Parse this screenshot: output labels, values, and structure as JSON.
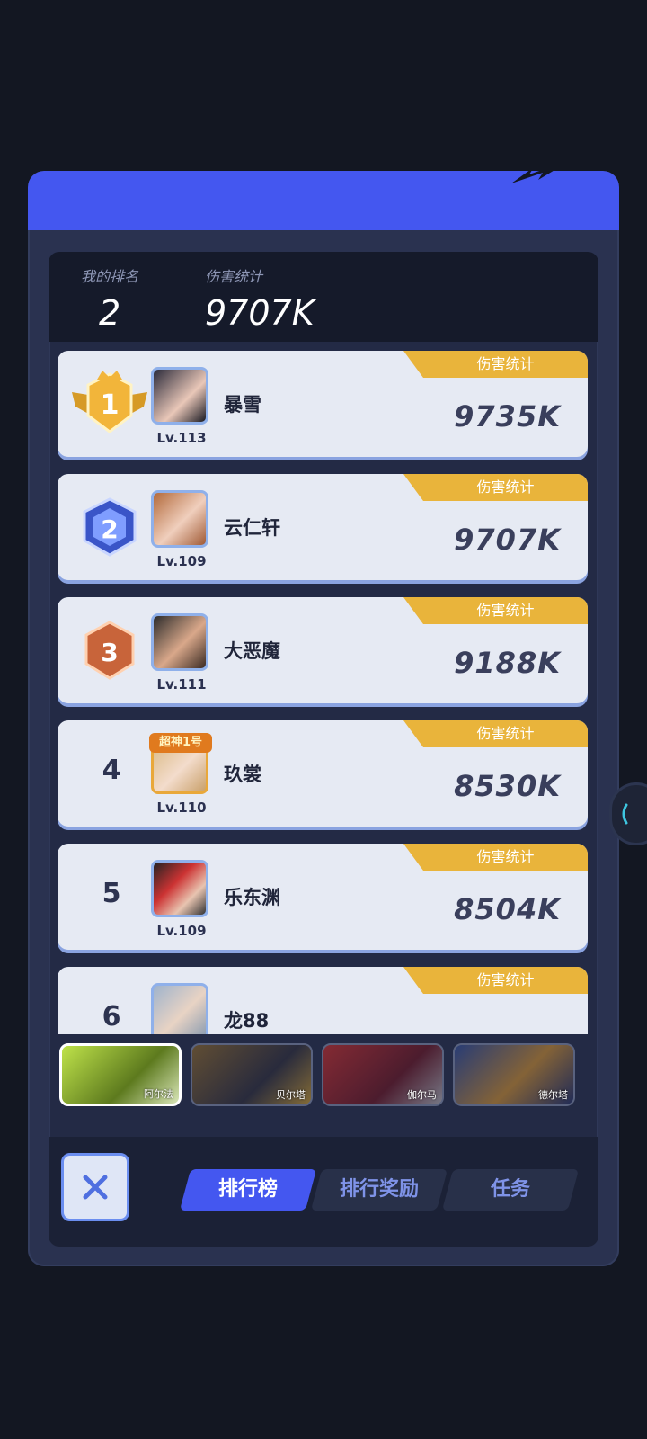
{
  "my_rank": {
    "rank_label": "我的排名",
    "rank_value": "2",
    "damage_label": "伤害统计",
    "damage_value": "9707K"
  },
  "ranking": [
    {
      "rank": "1",
      "name": "暴雪",
      "level": "Lv.113",
      "tag": "伤害统计",
      "score": "9735K",
      "badge": "gold"
    },
    {
      "rank": "2",
      "name": "云仁轩",
      "level": "Lv.109",
      "tag": "伤害统计",
      "score": "9707K",
      "badge": "blue"
    },
    {
      "rank": "3",
      "name": "大恶魔",
      "level": "Lv.111",
      "tag": "伤害统计",
      "score": "9188K",
      "badge": "bronze"
    },
    {
      "rank": "4",
      "name": "玖裳",
      "level": "Lv.110",
      "tag": "伤害统计",
      "score": "8530K",
      "badge": "",
      "avatar_frame": "超神1号"
    },
    {
      "rank": "5",
      "name": "乐东渊",
      "level": "Lv.109",
      "tag": "伤害统计",
      "score": "8504K",
      "badge": ""
    },
    {
      "rank": "6",
      "name": "龙88",
      "level": "",
      "tag": "伤害统计",
      "score": "",
      "badge": ""
    }
  ],
  "heroes": [
    {
      "name": "阿尔法",
      "active": true
    },
    {
      "name": "贝尔塔",
      "active": false
    },
    {
      "name": "伽尔马",
      "active": false
    },
    {
      "name": "德尔塔",
      "active": false
    }
  ],
  "tabs": [
    {
      "label": "排行榜",
      "active": true
    },
    {
      "label": "排行奖励",
      "active": false
    },
    {
      "label": "任务",
      "active": false
    }
  ],
  "colors": {
    "accent": "#4457f0",
    "gold_tag": "#e9b43b",
    "card_bg": "#e6eaf3",
    "panel_bg": "#2a3250"
  },
  "icons": {
    "close": "close-x-icon",
    "gold_badge": "rank-1-medal-icon",
    "silver_badge": "rank-2-medal-icon",
    "bronze_badge": "rank-3-medal-icon"
  }
}
